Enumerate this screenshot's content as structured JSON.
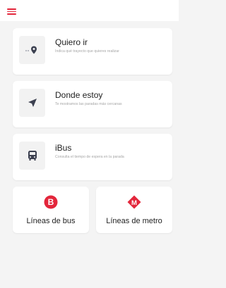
{
  "header": {
    "menu_icon": "hamburger-menu-icon"
  },
  "colors": {
    "accent": "#e3263b",
    "background": "#f4f4f4",
    "card": "#ffffff",
    "icon_dark": "#3c4050"
  },
  "cards": [
    {
      "title": "Quiero ir",
      "description": "Indica qué trayecto que quieres realizar",
      "icon": "route-pin-icon"
    },
    {
      "title": "Donde estoy",
      "description": "Te mostramos las paradas más cercanas",
      "icon": "location-arrow-icon"
    },
    {
      "title": "iBus",
      "description": "Consulta el tiempo de espera en la parada",
      "icon": "bus-icon"
    }
  ],
  "tiles": [
    {
      "label": "Líneas de bus",
      "logo_letter": "B",
      "icon": "bus-logo-icon"
    },
    {
      "label": "Líneas de metro",
      "logo_letter": "M",
      "icon": "metro-logo-icon"
    }
  ]
}
